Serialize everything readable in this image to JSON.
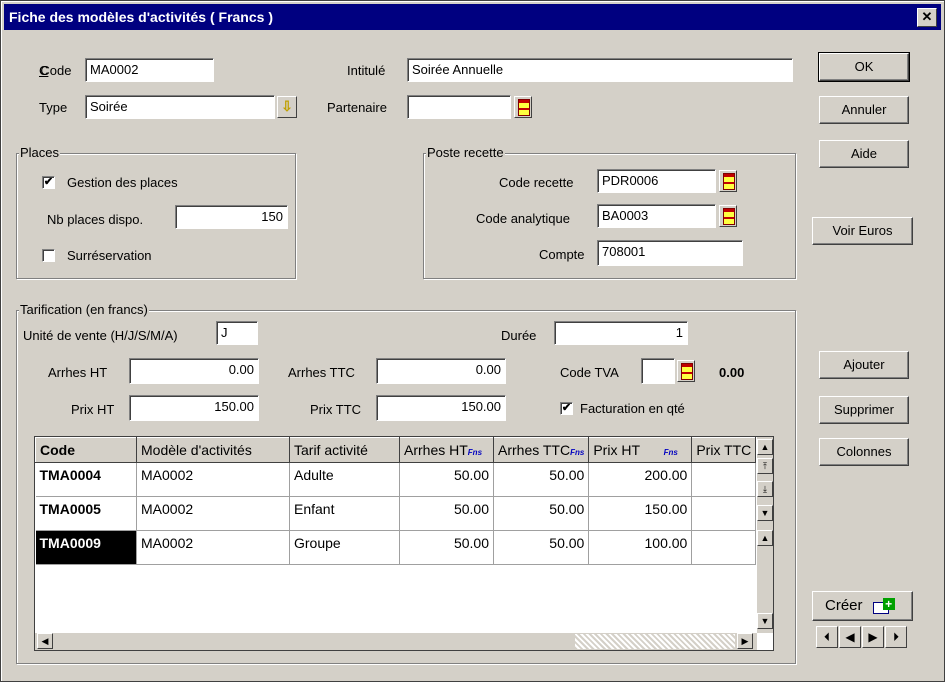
{
  "window": {
    "title": "Fiche des modèles d'activités ( Francs )",
    "close": "✕"
  },
  "header": {
    "code_label": "Code",
    "code_value": "MA0002",
    "intitule_label": "Intitulé",
    "intitule_value": "Soirée Annuelle",
    "type_label": "Type",
    "type_value": "Soirée",
    "partenaire_label": "Partenaire",
    "partenaire_value": ""
  },
  "buttons": {
    "ok": "OK",
    "annuler": "Annuler",
    "aide": "Aide",
    "voir_euros": "Voir Euros",
    "ajouter": "Ajouter",
    "supprimer": "Supprimer",
    "colonnes": "Colonnes",
    "creer": "Créer"
  },
  "places": {
    "title": "Places",
    "gestion_label": "Gestion des places",
    "gestion_checked": "✔",
    "nb_label": "Nb places dispo.",
    "nb_value": "150",
    "surreservation_label": "Surréservation"
  },
  "poste": {
    "title": "Poste recette",
    "code_recette_label": "Code recette",
    "code_recette_value": "PDR0006",
    "code_analytique_label": "Code analytique",
    "code_analytique_value": "BA0003",
    "compte_label": "Compte",
    "compte_value": "708001"
  },
  "tarification": {
    "title": "Tarification (en francs)",
    "unite_label": "Unité de vente (H/J/S/M/A)",
    "unite_value": "J",
    "duree_label": "Durée",
    "duree_value": "1",
    "arrhes_ht_label": "Arrhes HT",
    "arrhes_ht_value": "0.00",
    "arrhes_ttc_label": "Arrhes TTC",
    "arrhes_ttc_value": "0.00",
    "code_tva_label": "Code TVA",
    "code_tva_value": "",
    "tva_rate": "0.00",
    "prix_ht_label": "Prix HT",
    "prix_ht_value": "150.00",
    "prix_ttc_label": "Prix TTC",
    "prix_ttc_value": "150.00",
    "facturation_label": "Facturation en qté",
    "facturation_checked": "✔"
  },
  "grid": {
    "headers": [
      "Code",
      "Modèle d'activités",
      "Tarif activité",
      "Arrhes HT",
      "Arrhes TTC",
      "Prix HT",
      "Prix TTC"
    ],
    "fns": "Fns",
    "rows": [
      {
        "code": "TMA0004",
        "modele": "MA0002",
        "tarif": "Adulte",
        "arrhes_ht": "50.00",
        "arrhes_ttc": "50.00",
        "prix_ht": "200.00",
        "prix_ttc": ""
      },
      {
        "code": "TMA0005",
        "modele": "MA0002",
        "tarif": "Enfant",
        "arrhes_ht": "50.00",
        "arrhes_ttc": "50.00",
        "prix_ht": "150.00",
        "prix_ttc": ""
      },
      {
        "code": "TMA0009",
        "modele": "MA0002",
        "tarif": "Groupe",
        "arrhes_ht": "50.00",
        "arrhes_ttc": "50.00",
        "prix_ht": "100.00",
        "prix_ttc": ""
      }
    ]
  },
  "icons": {
    "up": "▲",
    "down": "▼",
    "left": "◀",
    "right": "▶",
    "first": "⏮",
    "last": "⏭",
    "first_row": "⤒",
    "last_row": "⤓"
  }
}
